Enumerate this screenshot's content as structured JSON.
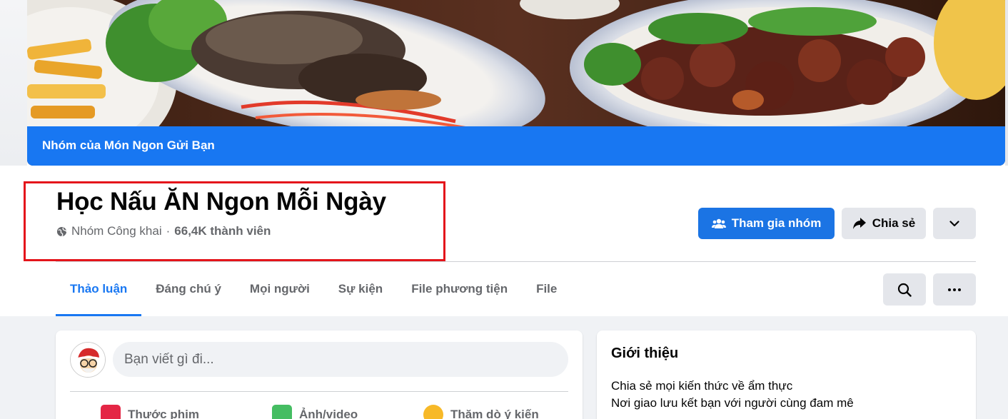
{
  "cover": {
    "banner_text": "Nhóm của Món Ngon Gửi Bạn"
  },
  "group": {
    "title": "Học Nấu ĂN Ngon Mỗi Ngày",
    "privacy": "Nhóm Công khai",
    "separator": "·",
    "members": "66,4K thành viên",
    "privacy_icon": "globe-icon"
  },
  "actions": {
    "join_label": "Tham gia nhóm",
    "join_icon": "people-icon",
    "share_label": "Chia sẻ",
    "share_icon": "share-arrow-icon",
    "more_icon": "chevron-down-icon"
  },
  "tabs": [
    {
      "label": "Thảo luận",
      "active": true
    },
    {
      "label": "Đáng chú ý",
      "active": false
    },
    {
      "label": "Mọi người",
      "active": false
    },
    {
      "label": "Sự kiện",
      "active": false
    },
    {
      "label": "File phương tiện",
      "active": false
    },
    {
      "label": "File",
      "active": false
    }
  ],
  "toolbar": {
    "search_icon": "search-icon",
    "more_icon": "ellipsis-icon"
  },
  "composer": {
    "placeholder": "Bạn viết gì đi...",
    "actions": [
      {
        "label": "Thước phim",
        "icon": "reels-icon",
        "color": "#e42645"
      },
      {
        "label": "Ảnh/video",
        "icon": "photo-icon",
        "color": "#45bd62"
      },
      {
        "label": "Thăm dò ý kiến",
        "icon": "poll-icon",
        "color": "#f7b928"
      }
    ]
  },
  "intro": {
    "title": "Giới thiệu",
    "lines": [
      "Chia sẻ mọi kiến thức về ẩm thực",
      "Nơi giao lưu kết bạn với người cùng đam mê"
    ]
  },
  "colors": {
    "accent": "#1877f2",
    "highlight_box": "#e4141b",
    "page_bg": "#f0f2f5"
  }
}
